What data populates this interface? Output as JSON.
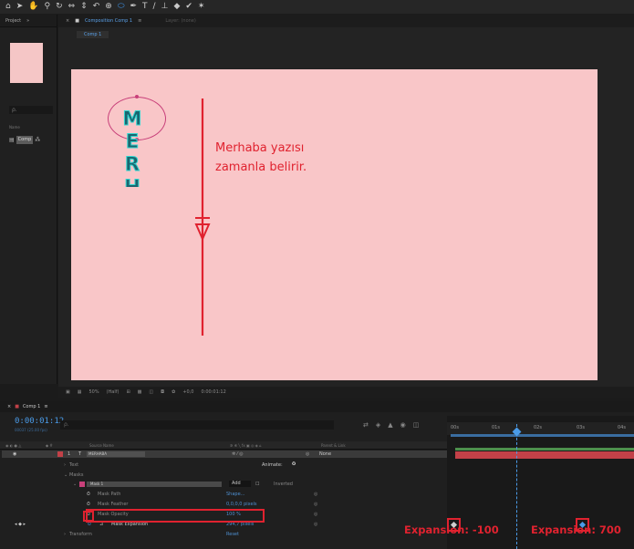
{
  "toolbar": {
    "icons": [
      "home-icon",
      "selection-icon",
      "hand-icon",
      "zoom-icon",
      "orbit-icon",
      "pan-icon",
      "dolly-icon",
      "rotate-icon",
      "camera-icon",
      "pen-icon",
      "text-icon",
      "brush-icon",
      "clone-icon",
      "eraser-icon",
      "roto-icon",
      "puppet-icon"
    ]
  },
  "project": {
    "tab": "Project",
    "search_placeholder": "ρ.",
    "name_header": "Name",
    "item": "Comp"
  },
  "composition": {
    "tab": "Composition Comp 1",
    "layer_tab": "Layer: (none)",
    "breadcrumb": "Comp 1",
    "letters": [
      "M",
      "E",
      "R",
      "H"
    ],
    "annotation_line1": "Merhaba yazısı",
    "annotation_line2": "zamanla belirir.",
    "zoom": "50%",
    "resolution": "(Half)",
    "exposure": "+0,0",
    "timecode_small": "0:00:01:12"
  },
  "timeline": {
    "tab": "Comp 1",
    "timecode": "0:00:01:12",
    "fps": "00037 (25.00 fps)",
    "search_placeholder": "ρ.",
    "headers": {
      "source_name": "Source Name",
      "parent": "Parent & Link"
    },
    "layer_number": "1",
    "layer_name": "MERHABA",
    "parent_value": "None",
    "rows": {
      "text": "Text",
      "animate": "Animate:",
      "masks": "Masks",
      "mask1": "Mask 1",
      "mode": "Add",
      "inverted": "Inverted",
      "mask_path": "Mask Path",
      "mask_path_value": "Shape...",
      "mask_feather": "Mask Feather",
      "mask_feather_value": "0,0,0,0 pixels",
      "mask_opacity": "Mask Opacity",
      "mask_opacity_value": "100 %",
      "mask_expansion": "Mask Expansion",
      "mask_expansion_value": "294,7 pixels",
      "transform": "Transform",
      "transform_value": "Reset"
    },
    "ruler": [
      "00s",
      "01s",
      "02s",
      "03s",
      "04s"
    ],
    "labels": {
      "left": "Expansion: -100",
      "right": "Expansion: 700"
    }
  },
  "colors": {
    "accent": "#4a9be8",
    "annotation": "#e0222f",
    "canvas": "#f9c6c8",
    "label_red": "#c24148"
  }
}
